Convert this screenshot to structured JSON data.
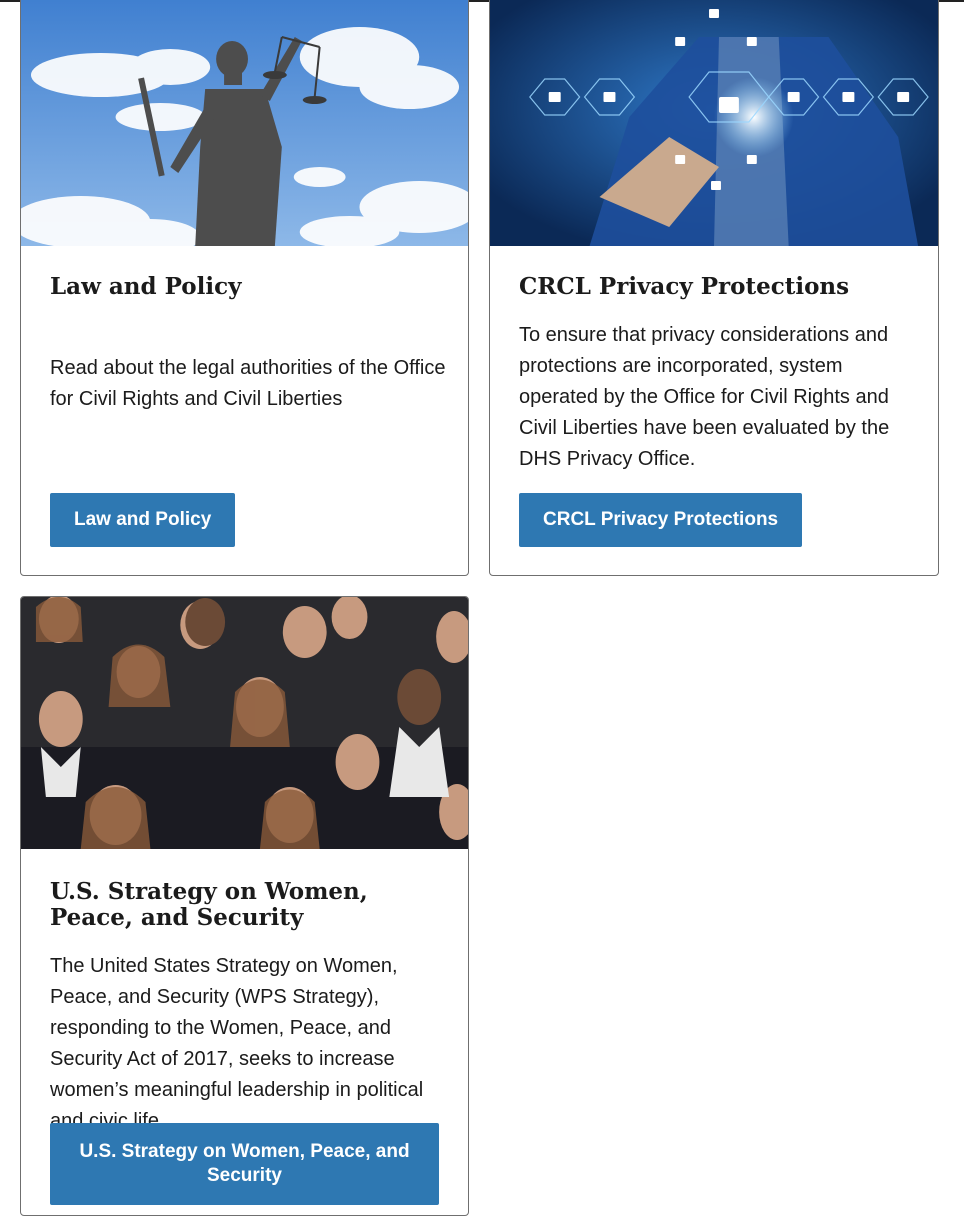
{
  "cards": [
    {
      "title": "Law and Policy",
      "description": "Read about the legal authorities of the Office for Civil Rights and Civil Liberties",
      "button_label": "Law and Policy",
      "image": "statue-of-justice-photo"
    },
    {
      "title": "CRCL Privacy Protections",
      "description": "To ensure that privacy considerations and protections are incorporated, system operated by the Office for Civil Rights and Civil Liberties have been evaluated by the DHS Privacy Office.",
      "button_label": "CRCL Privacy Protections",
      "image": "digital-padlock-security-photo"
    },
    {
      "title": "U.S. Strategy on Women, Peace, and Security",
      "description": "The United States Strategy on Women, Peace, and Security (WPS Strategy), responding to the Women, Peace, and Security Act of 2017, seeks to increase women’s meaningful leadership in political and civic life.",
      "button_label": "U.S. Strategy on Women, Peace, and Security",
      "image": "group-of-women-photo"
    }
  ],
  "colors": {
    "button": "#2e78b2",
    "card_border": "#6f6f6f",
    "text": "#1b1b1b"
  }
}
